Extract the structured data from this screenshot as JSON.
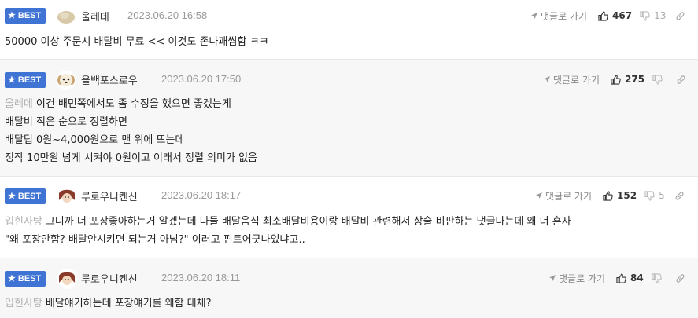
{
  "colors": {
    "badge": "#3f73d4",
    "muted": "#999999",
    "alt_bg": "#f7f7f7"
  },
  "comments": [
    {
      "badge": "BEST",
      "badge_icon": "star-icon",
      "nick": "울레데",
      "avatar_icon": "blob-avatar-icon",
      "date": "2023.06.20 16:58",
      "reply_label": "댓글로 가기",
      "up": "467",
      "down": "13",
      "mention": "",
      "lines": [
        "50000 이상 주문시 배달비 무료 << 이것도 존나괘씸함 ㅋㅋ"
      ]
    },
    {
      "badge": "BEST",
      "badge_icon": "star-icon",
      "nick": "올백포스로우",
      "avatar_icon": "puppy-avatar-icon",
      "date": "2023.06.20 17:50",
      "reply_label": "댓글로 가기",
      "up": "275",
      "down": "",
      "mention": "울레데",
      "lines": [
        "이건 배민쪽에서도 좀 수정을 했으면 좋겠는게",
        "배달비 적은 순으로 정렬하면",
        "배달팁 0원~4,000원으로 맨 위에 뜨는데",
        "정작 10만원 넘게 시켜야 0원이고 이래서 정렬 의미가 없음"
      ]
    },
    {
      "badge": "BEST",
      "badge_icon": "star-icon",
      "nick": "루로우니켄신",
      "avatar_icon": "character-avatar-icon",
      "date": "2023.06.20 18:17",
      "reply_label": "댓글로 가기",
      "up": "152",
      "down": "5",
      "mention": "입힌사탕",
      "lines": [
        "그니까 너 포장좋아하는거 알겠는데 다들 배달음식 최소배달비용이랑 배달비 관련해서 상술 비판하는 댓글다는데 왜 너 혼자",
        "\"왜 포장안함? 배달안시키면 되는거 아님?\" 이러고 핀트어긋나있냐고.."
      ]
    },
    {
      "badge": "BEST",
      "badge_icon": "star-icon",
      "nick": "루로우니켄신",
      "avatar_icon": "character-avatar-icon",
      "date": "2023.06.20 18:11",
      "reply_label": "댓글로 가기",
      "up": "84",
      "down": "",
      "mention": "입힌사탕",
      "lines": [
        "배달얘기하는데 포장얘기를 왜함 대체?"
      ]
    }
  ]
}
